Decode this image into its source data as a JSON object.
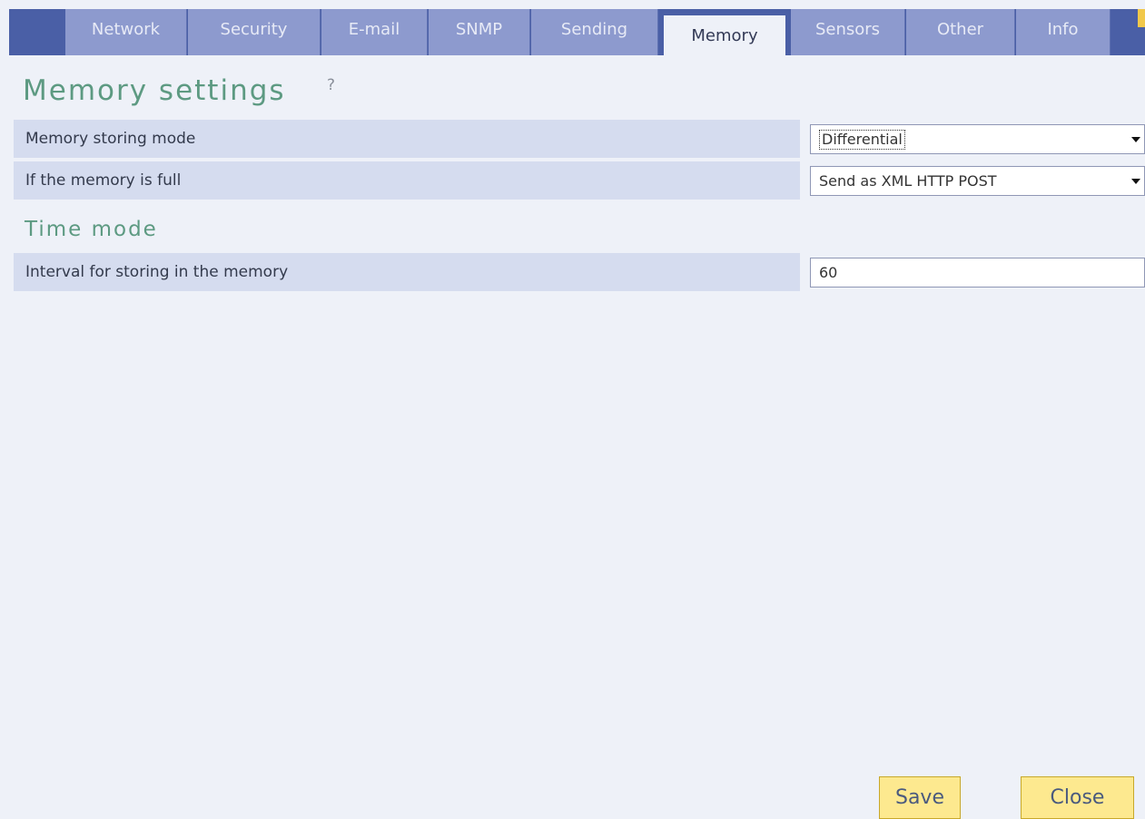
{
  "tabs": [
    {
      "label": "Network",
      "active": false
    },
    {
      "label": "Security",
      "active": false
    },
    {
      "label": "E-mail",
      "active": false
    },
    {
      "label": "SNMP",
      "active": false
    },
    {
      "label": "Sending",
      "active": false
    },
    {
      "label": "Memory",
      "active": true
    },
    {
      "label": "Sensors",
      "active": false
    },
    {
      "label": "Other",
      "active": false
    },
    {
      "label": "Info",
      "active": false
    }
  ],
  "page": {
    "title": "Memory settings",
    "help": "?"
  },
  "settings": {
    "storing_mode": {
      "label": "Memory storing mode",
      "value": "Differential"
    },
    "memory_full": {
      "label": "If the memory is full",
      "value": "Send as XML HTTP POST"
    }
  },
  "time_mode": {
    "title": "Time mode",
    "interval": {
      "label": "Interval for storing in the memory",
      "value": "60"
    }
  },
  "buttons": {
    "save": "Save",
    "close": "Close"
  },
  "colors": {
    "background": "#eef1f8",
    "tab_bar": "#4a5fa6",
    "tab": "#8d9ace",
    "row_label": "#d5dcef",
    "heading": "#5d9a82",
    "button": "#fde98f"
  }
}
